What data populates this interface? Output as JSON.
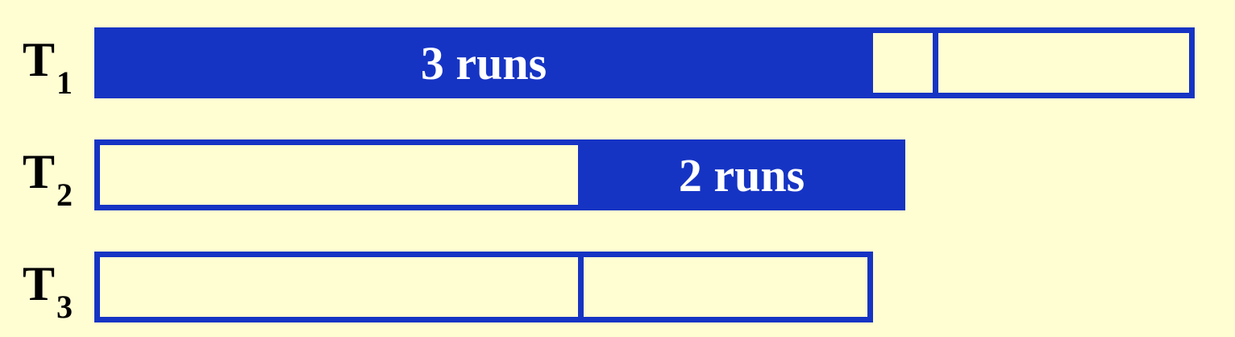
{
  "colors": {
    "background": "#FFFDD2",
    "tape_blue": "#1634C4",
    "label_text": "#000000",
    "run_text": "#FFFFFF"
  },
  "tapes": [
    {
      "label": "T",
      "subscript": "1",
      "segments": [
        {
          "filled": true,
          "text": "3 runs"
        },
        {
          "filled": false,
          "text": ""
        },
        {
          "filled": false,
          "text": ""
        }
      ]
    },
    {
      "label": "T",
      "subscript": "2",
      "segments": [
        {
          "filled": false,
          "text": ""
        },
        {
          "filled": true,
          "text": "2 runs"
        }
      ]
    },
    {
      "label": "T",
      "subscript": "3",
      "segments": [
        {
          "filled": false,
          "text": ""
        },
        {
          "filled": false,
          "text": ""
        }
      ]
    }
  ]
}
